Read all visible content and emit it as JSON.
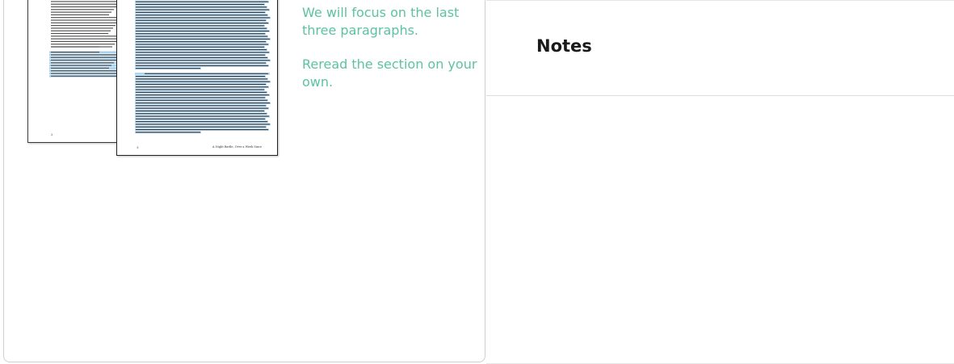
{
  "document": {
    "back_page_number": "2",
    "front_page_number": "3",
    "front_page_footer": "A Night Battle, Over a Week Since"
  },
  "instructions": {
    "focus": "We will focus on the last three paragraphs.",
    "reread": "Reread the section on your own."
  },
  "notes": {
    "title": "Notes"
  },
  "colors": {
    "instruction_text": "#5cc2a3",
    "highlight": "#a9d2ee",
    "card_border": "#cfcfcf"
  }
}
